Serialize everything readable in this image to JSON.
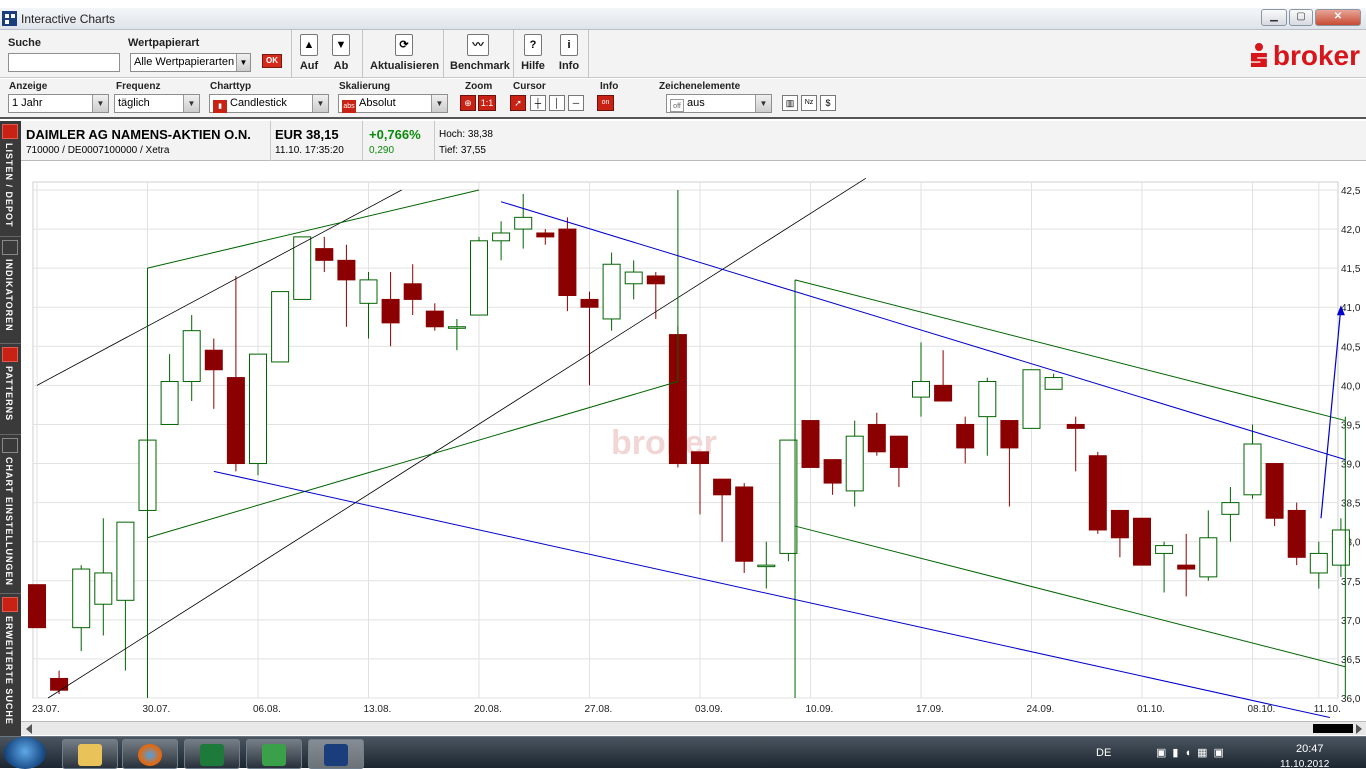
{
  "window": {
    "title": "Interactive Charts",
    "minimize": "▁",
    "maximize": "▢",
    "close": "✕"
  },
  "toolbar": {
    "search_label": "Suche",
    "search_value": "",
    "security_type_label": "Wertpapierart",
    "security_type_value": "Alle Wertpapierarten",
    "ok_label": "OK",
    "up_label": "Auf",
    "down_label": "Ab",
    "refresh_label": "Aktualisieren",
    "benchmark_label": "Benchmark",
    "help_label": "Hilfe",
    "info_label": "Info",
    "help_icon_glyph": "?",
    "info_icon_glyph": "i",
    "brand": "broker"
  },
  "options": {
    "anzeige_label": "Anzeige",
    "anzeige_value": "1 Jahr",
    "frequenz_label": "Frequenz",
    "frequenz_value": "täglich",
    "charttyp_label": "Charttyp",
    "charttyp_value": "Candlestick",
    "skalierung_label": "Skalierung",
    "skalierung_value": "Absolut",
    "skalierung_badge": "abs",
    "zoom_label": "Zoom",
    "zoom_reset": "1:1",
    "cursor_label": "Cursor",
    "info_label": "Info",
    "info_toggle": "on",
    "zeichen_label": "Zeichenelemente",
    "zeichen_value": "aus",
    "zeichen_badge": "off"
  },
  "sidebar": {
    "items": [
      {
        "label": "LISTEN / DEPOT",
        "icon": "folder-icon"
      },
      {
        "label": "INDIKATOREN",
        "icon": "indicator-icon"
      },
      {
        "label": "PATTERNS",
        "icon": "patterns-icon"
      },
      {
        "label": "CHART EINSTELLUNGEN",
        "icon": "settings-icon"
      },
      {
        "label": "ERWEITERTE SUCHE",
        "icon": "search-icon"
      }
    ]
  },
  "instrument": {
    "name": "DAIMLER AG NAMENS-AKTIEN O.N.",
    "ids": "710000 / DE0007100000 / Xetra",
    "price": "EUR 38,15",
    "time": "11.10. 17:35:20",
    "change_pct": "+0,766%",
    "change_abs": "0,290",
    "high": "Hoch: 38,38",
    "low": "Tief: 37,55",
    "positive_color": "#0a8a0a"
  },
  "taskbar": {
    "lang": "DE",
    "time": "20:47",
    "date": "11.10.2012"
  },
  "chart_data": {
    "type": "candlestick",
    "watermark": "broker",
    "ylim": [
      36.0,
      42.5
    ],
    "yticks": [
      "42,5",
      "42,0",
      "41,5",
      "41,0",
      "40,5",
      "40,0",
      "39,5",
      "39,0",
      "38,5",
      "38,0",
      "37,5",
      "37,0",
      "36,5",
      "36,0"
    ],
    "xticks": [
      {
        "label": "23.07.",
        "i": 0
      },
      {
        "label": "30.07.",
        "i": 5
      },
      {
        "label": "06.08.",
        "i": 10
      },
      {
        "label": "13.08.",
        "i": 15
      },
      {
        "label": "20.08.",
        "i": 20
      },
      {
        "label": "27.08.",
        "i": 25
      },
      {
        "label": "03.09.",
        "i": 30
      },
      {
        "label": "10.09.",
        "i": 35
      },
      {
        "label": "17.09.",
        "i": 40
      },
      {
        "label": "24.09.",
        "i": 45
      },
      {
        "label": "01.10.",
        "i": 50
      },
      {
        "label": "08.10.",
        "i": 55
      },
      {
        "label": "11.10.",
        "i": 58
      }
    ],
    "up_color": "#ffffff",
    "down_color": "#8b0000",
    "candles": [
      {
        "o": 37.45,
        "h": 37.2,
        "l": 36.9,
        "c": 36.9
      },
      {
        "o": 36.25,
        "h": 36.35,
        "l": 36.05,
        "c": 36.1
      },
      {
        "o": 36.9,
        "h": 37.7,
        "l": 36.6,
        "c": 37.65
      },
      {
        "o": 37.2,
        "h": 38.3,
        "l": 36.8,
        "c": 37.6
      },
      {
        "o": 37.25,
        "h": 37.25,
        "l": 36.35,
        "c": 38.25
      },
      {
        "o": 38.4,
        "h": 39.3,
        "l": 37.65,
        "c": 39.3
      },
      {
        "o": 39.5,
        "h": 40.4,
        "l": 39.5,
        "c": 40.05
      },
      {
        "o": 40.05,
        "h": 40.9,
        "l": 39.8,
        "c": 40.7
      },
      {
        "o": 40.45,
        "h": 40.6,
        "l": 39.7,
        "c": 40.2
      },
      {
        "o": 40.1,
        "h": 41.4,
        "l": 38.9,
        "c": 39.0
      },
      {
        "o": 39.0,
        "h": 40.4,
        "l": 38.85,
        "c": 40.4
      },
      {
        "o": 40.3,
        "h": 41.2,
        "l": 40.3,
        "c": 41.2
      },
      {
        "o": 41.1,
        "h": 41.9,
        "l": 41.1,
        "c": 41.9
      },
      {
        "o": 41.75,
        "h": 41.9,
        "l": 41.45,
        "c": 41.6
      },
      {
        "o": 41.6,
        "h": 41.8,
        "l": 40.75,
        "c": 41.35
      },
      {
        "o": 41.05,
        "h": 41.45,
        "l": 40.6,
        "c": 41.35
      },
      {
        "o": 41.1,
        "h": 41.45,
        "l": 40.5,
        "c": 40.8
      },
      {
        "o": 41.3,
        "h": 41.55,
        "l": 40.9,
        "c": 41.1
      },
      {
        "o": 40.95,
        "h": 41.05,
        "l": 40.7,
        "c": 40.75
      },
      {
        "o": 40.75,
        "h": 40.85,
        "l": 40.45,
        "c": 40.75
      },
      {
        "o": 40.9,
        "h": 41.9,
        "l": 40.9,
        "c": 41.85
      },
      {
        "o": 41.85,
        "h": 42.1,
        "l": 41.6,
        "c": 41.95
      },
      {
        "o": 42.0,
        "h": 42.45,
        "l": 41.75,
        "c": 42.15
      },
      {
        "o": 41.95,
        "h": 42.0,
        "l": 41.8,
        "c": 41.9
      },
      {
        "o": 42.0,
        "h": 42.15,
        "l": 40.95,
        "c": 41.15
      },
      {
        "o": 41.1,
        "h": 41.2,
        "l": 40.0,
        "c": 41.0
      },
      {
        "o": 40.85,
        "h": 41.7,
        "l": 40.7,
        "c": 41.55
      },
      {
        "o": 41.3,
        "h": 41.6,
        "l": 41.1,
        "c": 41.45
      },
      {
        "o": 41.4,
        "h": 41.45,
        "l": 40.85,
        "c": 41.3
      },
      {
        "o": 40.65,
        "h": 40.75,
        "l": 38.95,
        "c": 39.0
      },
      {
        "o": 39.15,
        "h": 39.15,
        "l": 38.35,
        "c": 39.0
      },
      {
        "o": 38.8,
        "h": 38.8,
        "l": 38.0,
        "c": 38.6
      },
      {
        "o": 38.7,
        "h": 38.75,
        "l": 37.6,
        "c": 37.75
      },
      {
        "o": 37.7,
        "h": 38.0,
        "l": 37.4,
        "c": 37.7
      },
      {
        "o": 37.85,
        "h": 39.3,
        "l": 37.75,
        "c": 39.3
      },
      {
        "o": 39.55,
        "h": 39.55,
        "l": 38.95,
        "c": 38.95
      },
      {
        "o": 39.05,
        "h": 39.05,
        "l": 38.6,
        "c": 38.75
      },
      {
        "o": 38.65,
        "h": 39.55,
        "l": 38.45,
        "c": 39.35
      },
      {
        "o": 39.5,
        "h": 39.65,
        "l": 39.1,
        "c": 39.15
      },
      {
        "o": 39.35,
        "h": 39.35,
        "l": 38.7,
        "c": 38.95
      },
      {
        "o": 39.85,
        "h": 40.55,
        "l": 39.6,
        "c": 40.05
      },
      {
        "o": 40.0,
        "h": 40.45,
        "l": 39.85,
        "c": 39.8
      },
      {
        "o": 39.5,
        "h": 39.6,
        "l": 39.0,
        "c": 39.2
      },
      {
        "o": 39.6,
        "h": 40.1,
        "l": 39.1,
        "c": 40.05
      },
      {
        "o": 39.55,
        "h": 39.55,
        "l": 38.45,
        "c": 39.2
      },
      {
        "o": 39.45,
        "h": 40.2,
        "l": 39.45,
        "c": 40.2
      },
      {
        "o": 39.95,
        "h": 40.15,
        "l": 39.95,
        "c": 40.1
      },
      {
        "o": 39.5,
        "h": 39.6,
        "l": 38.9,
        "c": 39.45
      },
      {
        "o": 39.1,
        "h": 39.15,
        "l": 38.1,
        "c": 38.15
      },
      {
        "o": 38.4,
        "h": 38.4,
        "l": 37.8,
        "c": 38.05
      },
      {
        "o": 38.3,
        "h": 38.3,
        "l": 37.7,
        "c": 37.7
      },
      {
        "o": 37.85,
        "h": 38.0,
        "l": 37.35,
        "c": 37.95
      },
      {
        "o": 37.7,
        "h": 38.1,
        "l": 37.3,
        "c": 37.65
      },
      {
        "o": 37.55,
        "h": 38.4,
        "l": 37.5,
        "c": 38.05
      },
      {
        "o": 38.35,
        "h": 38.7,
        "l": 38.0,
        "c": 38.5
      },
      {
        "o": 38.6,
        "h": 39.5,
        "l": 38.55,
        "c": 39.25
      },
      {
        "o": 39.0,
        "h": 39.0,
        "l": 38.2,
        "c": 38.3
      },
      {
        "o": 38.4,
        "h": 38.5,
        "l": 37.7,
        "c": 37.8
      },
      {
        "o": 37.6,
        "h": 38.0,
        "l": 37.4,
        "c": 37.85
      },
      {
        "o": 37.7,
        "h": 38.3,
        "l": 37.55,
        "c": 38.15
      }
    ],
    "drawings": [
      {
        "color": "#000000",
        "w": 0.8,
        "pts": [
          [
            0,
            40.0
          ],
          [
            16.5,
            42.5
          ]
        ]
      },
      {
        "color": "#000000",
        "w": 0.8,
        "pts": [
          [
            0.5,
            36.0
          ],
          [
            37.5,
            42.65
          ]
        ]
      },
      {
        "color": "#006400",
        "w": 1,
        "pts": [
          [
            5,
            41.5
          ],
          [
            20,
            42.5
          ]
        ]
      },
      {
        "color": "#006400",
        "w": 1,
        "pts": [
          [
            5,
            38.05
          ],
          [
            29,
            40.05
          ]
        ]
      },
      {
        "color": "#006400",
        "w": 1,
        "pts": [
          [
            5,
            41.5
          ],
          [
            5,
            36.0
          ]
        ]
      },
      {
        "color": "#006400",
        "w": 1,
        "pts": [
          [
            29,
            40.05
          ],
          [
            29,
            42.5
          ]
        ]
      },
      {
        "color": "#006400",
        "w": 1,
        "pts": [
          [
            34.3,
            36.0
          ],
          [
            34.3,
            41.35
          ]
        ]
      },
      {
        "color": "#006400",
        "w": 1,
        "pts": [
          [
            34.3,
            41.35
          ],
          [
            59.2,
            39.55
          ]
        ]
      },
      {
        "color": "#006400",
        "w": 1,
        "pts": [
          [
            34.3,
            38.2
          ],
          [
            59.2,
            36.4
          ]
        ]
      },
      {
        "color": "#006400",
        "w": 1,
        "pts": [
          [
            59.2,
            36.0
          ],
          [
            59.2,
            39.6
          ]
        ]
      },
      {
        "color": "#0000cc",
        "w": 1,
        "pts": [
          [
            21,
            42.35
          ],
          [
            59.2,
            39.05
          ]
        ]
      },
      {
        "color": "#0000cc",
        "w": 1,
        "pts": [
          [
            8,
            38.9
          ],
          [
            58.5,
            35.75
          ]
        ]
      },
      {
        "color": "#0000cc",
        "w": 1.2,
        "pts": [
          [
            58.1,
            38.3
          ],
          [
            59.0,
            41.0
          ]
        ],
        "arrow": true
      }
    ]
  }
}
